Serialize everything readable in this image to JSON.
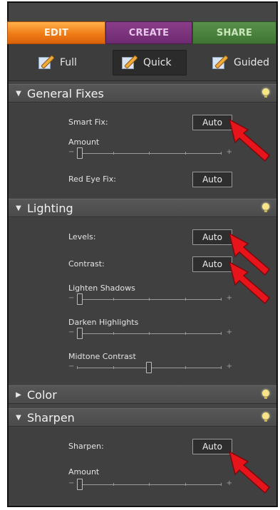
{
  "mode_tabs": [
    {
      "label": "EDIT"
    },
    {
      "label": "CREATE"
    },
    {
      "label": "SHARE"
    }
  ],
  "submodes": [
    {
      "label": "Full",
      "icon": "full-edit-icon"
    },
    {
      "label": "Quick",
      "icon": "quick-fix-icon"
    },
    {
      "label": "Guided",
      "icon": "guided-edit-icon"
    }
  ],
  "sections": {
    "general_fixes": {
      "title": "General Fixes",
      "smart_fix_label": "Smart Fix:",
      "smart_fix_button": "Auto",
      "amount_label": "Amount",
      "amount_value": 0.02,
      "red_eye_label": "Red Eye Fix:",
      "red_eye_button": "Auto"
    },
    "lighting": {
      "title": "Lighting",
      "levels_label": "Levels:",
      "levels_button": "Auto",
      "contrast_label": "Contrast:",
      "contrast_button": "Auto",
      "lighten_shadows_label": "Lighten Shadows",
      "lighten_shadows_value": 0.02,
      "darken_highlights_label": "Darken Highlights",
      "darken_highlights_value": 0.02,
      "midtone_contrast_label": "Midtone Contrast",
      "midtone_contrast_value": 0.5
    },
    "color": {
      "title": "Color"
    },
    "sharpen": {
      "title": "Sharpen",
      "sharpen_label": "Sharpen:",
      "sharpen_button": "Auto",
      "amount_label": "Amount",
      "amount_value": 0.02
    }
  },
  "slider_signs": {
    "minus": "−",
    "plus": "+"
  },
  "colors": {
    "edit_tab": "#f07c16",
    "create_tab": "#6e2b70",
    "share_tab": "#3f7434",
    "panel": "#404040",
    "annotation_arrow": "#e8141c"
  }
}
